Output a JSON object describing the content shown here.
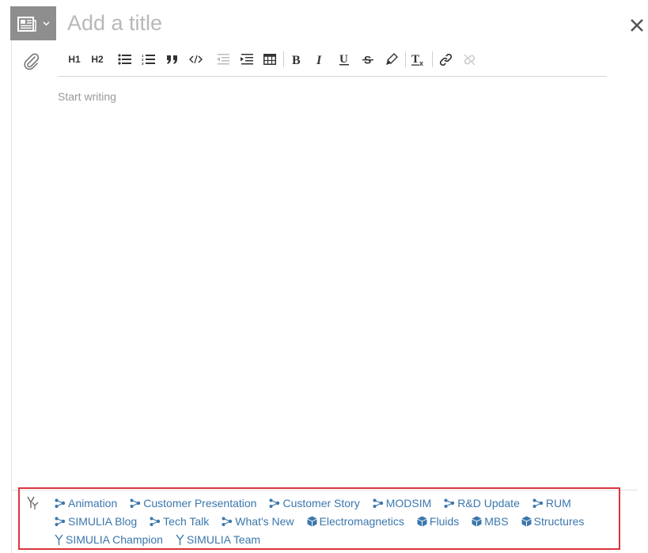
{
  "editor": {
    "title_placeholder": "Add a title",
    "body_placeholder": "Start writing",
    "post_type_icon": "newspaper-icon"
  },
  "toolbar": {
    "h1_label": "H1",
    "h2_label": "H2",
    "buttons": [
      "heading-1",
      "heading-2",
      "bulleted-list",
      "numbered-list",
      "blockquote",
      "code",
      "outdent",
      "indent",
      "table",
      "bold",
      "italic",
      "underline",
      "strikethrough",
      "highlight",
      "clear-formatting",
      "link",
      "unlink"
    ]
  },
  "tags": {
    "row1": [
      {
        "label": "Animation",
        "icon": "topic-icon"
      },
      {
        "label": "Customer Presentation",
        "icon": "topic-icon"
      },
      {
        "label": "Customer Story",
        "icon": "topic-icon"
      },
      {
        "label": "MODSIM",
        "icon": "topic-icon"
      },
      {
        "label": "R&D Update",
        "icon": "topic-icon"
      },
      {
        "label": "RUM",
        "icon": "topic-icon"
      }
    ],
    "row2": [
      {
        "label": "SIMULIA Blog",
        "icon": "topic-icon"
      },
      {
        "label": "Tech Talk",
        "icon": "topic-icon"
      },
      {
        "label": "What's New",
        "icon": "topic-icon"
      },
      {
        "label": "Electromagnetics",
        "icon": "cube-icon"
      },
      {
        "label": "Fluids",
        "icon": "cube-icon"
      },
      {
        "label": "MBS",
        "icon": "cube-icon"
      },
      {
        "label": "Structures",
        "icon": "cube-icon"
      }
    ],
    "row3": [
      {
        "label": "SIMULIA Champion",
        "icon": "fork-icon"
      },
      {
        "label": "SIMULIA Team",
        "icon": "fork-icon"
      }
    ]
  },
  "colors": {
    "tag_text": "#3b77ac",
    "highlight_border": "#d9363e",
    "type_button_bg": "#8e8e8e"
  }
}
